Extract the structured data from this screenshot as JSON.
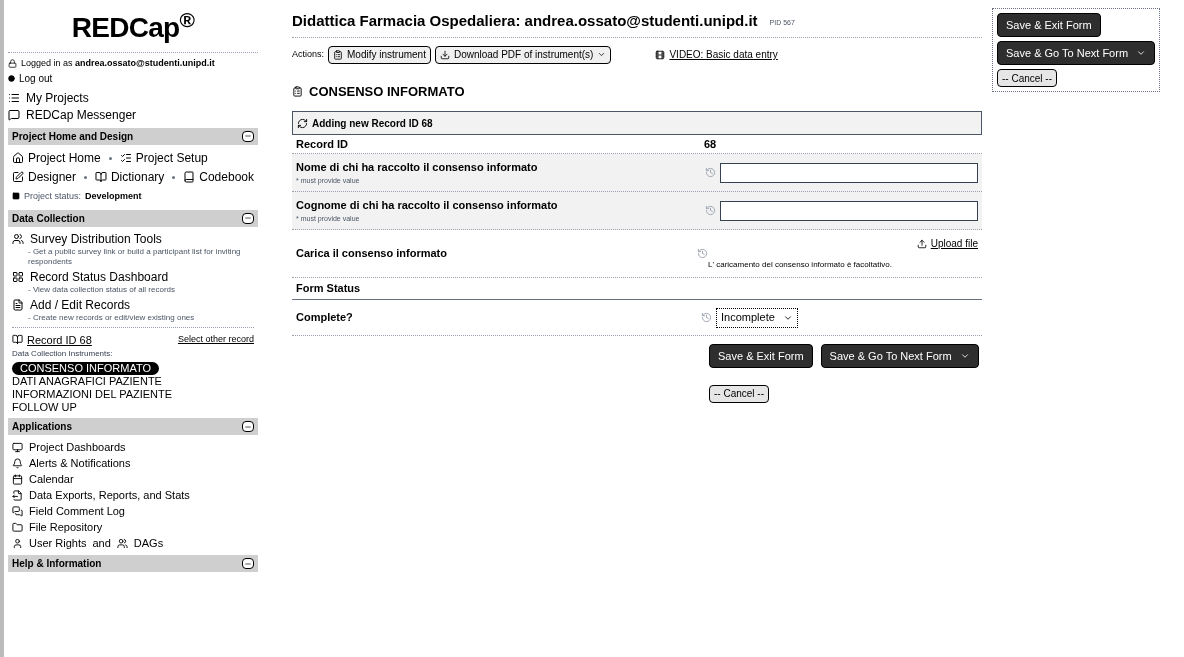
{
  "sidebar": {
    "logo": "REDCap$^{®}$",
    "logged_in": "Logged in as **andrea.ossato@studenti.unipd.it**",
    "logout": "Log out",
    "links": [
      "My Projects",
      "REDCap Messenger"
    ],
    "design": {
      "header": "Project Home and Design",
      "rows": [
        [
          "Project Home",
          "Project Setup"
        ],
        [
          "Designer",
          "Dictionary",
          "Codebook"
        ]
      ],
      "status_label": "Project status:",
      "status": "Development"
    },
    "collection": {
      "header": "Data Collection",
      "tools": [
        {
          "label": "Survey Distribution Tools",
          "desc": "- Get a public survey link or build a participant list for inviting respondents"
        },
        {
          "label": "Record Status Dashboard",
          "desc": "- View data collection status of all records"
        },
        {
          "label": "Add / Edit Records",
          "desc": "- Create new records or edit/view existing ones"
        }
      ],
      "record": "Record ID 68",
      "select_other": "Select other record",
      "instruments_label": "Data Collection Instruments:",
      "instruments": [
        {
          "label": "CONSENSO INFORMATO",
          "selected": true
        },
        {
          "label": "DATI ANAGRAFICI PAZIENTE",
          "selected": false
        },
        {
          "label": "INFORMAZIONI DEL PAZIENTE",
          "selected": false
        },
        {
          "label": "FOLLOW UP",
          "selected": false
        }
      ]
    },
    "applications": {
      "header": "Applications",
      "items": [
        {
          "label": "Project Dashboards"
        },
        {
          "label": "Alerts & Notifications"
        },
        {
          "label": "Calendar"
        },
        {
          "label": "Data Exports, Reports, and Stats"
        },
        {
          "label": "Field Comment Log"
        },
        {
          "label": "File Repository"
        },
        {
          "label": "User Rights",
          "joiner": "and",
          "extra": "DAGs"
        }
      ]
    },
    "help": {
      "header": "Help & Information"
    }
  },
  "main": {
    "title": "Didattica Farmacia Ospedaliera: andrea.ossato@studenti.unipd.it",
    "pid": "PID 567",
    "actions_label": "Actions:",
    "actions": [
      "Modify instrument",
      "Download PDF of instrument(s)"
    ],
    "video": "VIDEO: Basic data entry",
    "form_title": "CONSENSO INFORMATO",
    "banner": "Adding new Record ID 68",
    "fields": [
      {
        "kind": "static",
        "label": "Record ID",
        "value": "68"
      },
      {
        "kind": "text",
        "label": "Nome di chi ha raccolto il consenso informato",
        "note": "* must provide value"
      },
      {
        "kind": "text",
        "label": "Cognome di chi ha raccolto il consenso informato",
        "note": "* must provide value"
      },
      {
        "kind": "file",
        "label": "Carica il consenso informato",
        "link": "Upload file",
        "note": "L' caricamento del consenso informato è facoltativo."
      },
      {
        "kind": "header",
        "label": "Form Status"
      },
      {
        "kind": "select",
        "label": "Complete?",
        "value": "Incomplete"
      }
    ],
    "buttons": {
      "save_exit": "Save & Exit Form",
      "save_next": "Save & Go To Next Form",
      "cancel": "-- Cancel --"
    }
  },
  "floating": {
    "save_exit": "Save & Exit Form",
    "save_next": "Save & Go To Next Form",
    "cancel": "-- Cancel --"
  }
}
